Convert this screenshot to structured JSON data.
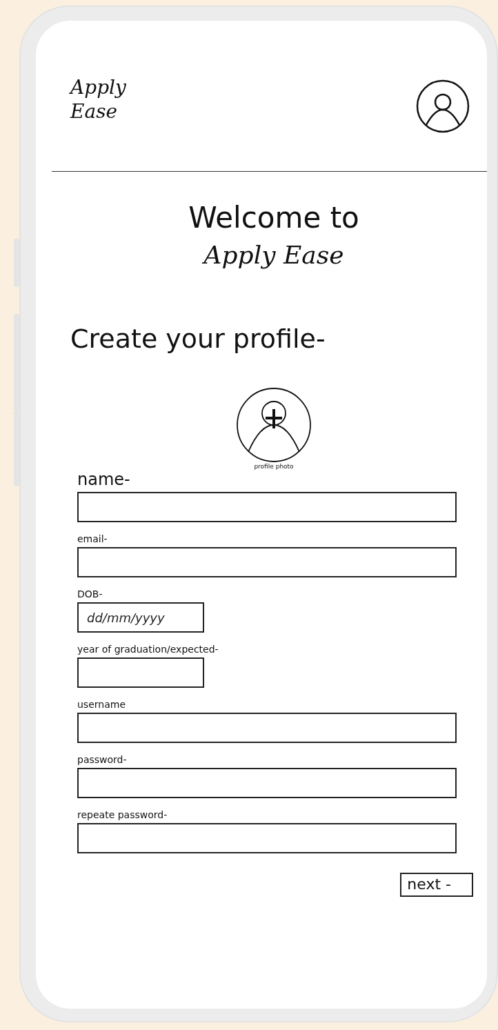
{
  "header": {
    "logo": "Apply Ease"
  },
  "welcome": [
    "Welcome to",
    "Apply Ease"
  ],
  "heading": "Create your profile-",
  "photo": {
    "caption": "profile photo"
  },
  "fields": [
    {
      "label": "name-",
      "kind": "wide"
    },
    {
      "label": "email-",
      "kind": "wide"
    },
    {
      "label": "DOB-",
      "kind": "narrow",
      "placeholder": "dd/mm/yyyy"
    },
    {
      "label": "year of graduation/expected-",
      "kind": "narrow"
    },
    {
      "label": "username",
      "kind": "wide"
    },
    {
      "label": "password-",
      "kind": "wide"
    },
    {
      "label": "repeate password-",
      "kind": "wide"
    }
  ],
  "next_button": "next -"
}
